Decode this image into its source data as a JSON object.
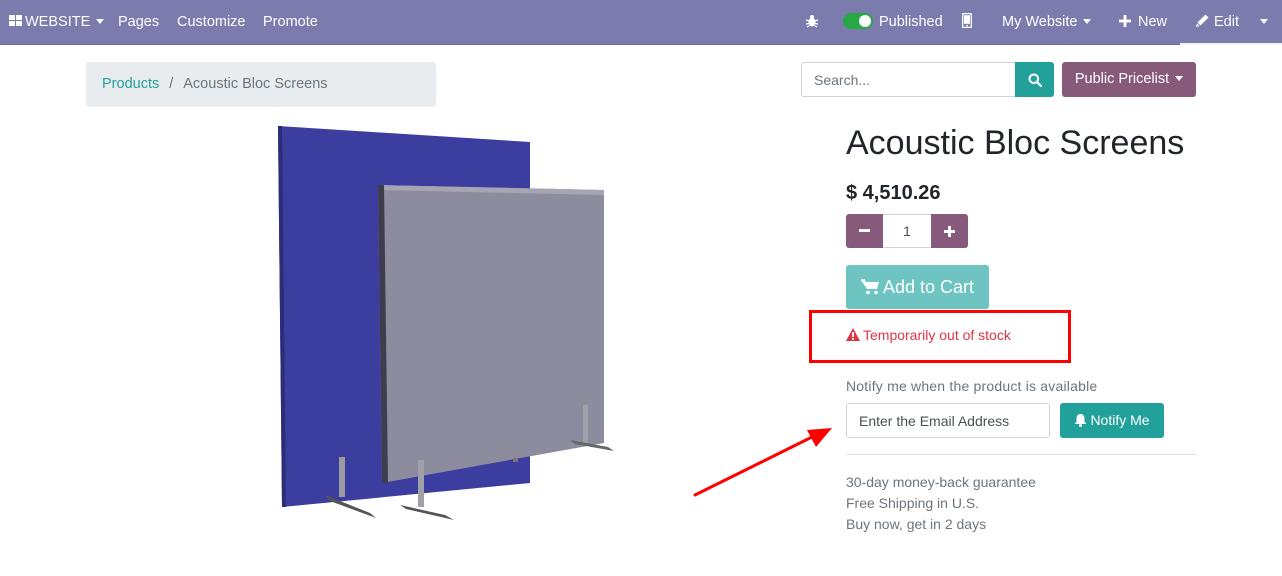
{
  "topbar": {
    "website_label": "WEBSITE",
    "pages_label": "Pages",
    "customize_label": "Customize",
    "promote_label": "Promote",
    "published_label": "Published",
    "my_website_label": "My Website",
    "new_label": "New",
    "edit_label": "Edit",
    "bar_color": "#7c7bad"
  },
  "breadcrumb": {
    "parent": "Products",
    "separator": "/",
    "current": "Acoustic Bloc Screens"
  },
  "search": {
    "placeholder": "Search..."
  },
  "pricelist": {
    "label": "Public Pricelist"
  },
  "product": {
    "name": "Acoustic Bloc Screens",
    "price": "$ 4,510.26",
    "quantity": "1",
    "add_to_cart_label": "Add to Cart",
    "stock_message": "Temporarily out of stock",
    "notify_label": "Notify me when the product is available",
    "email_placeholder": "Enter the Email Address",
    "notify_button_label": "Notify Me",
    "terms": [
      "30-day money-back guarantee",
      "Free Shipping in U.S.",
      "Buy now, get in 2 days"
    ]
  },
  "colors": {
    "primary_teal": "#21a19a",
    "secondary_purple": "#875a7b",
    "danger_red": "#dc3545",
    "annotation_red": "#ff0000"
  }
}
